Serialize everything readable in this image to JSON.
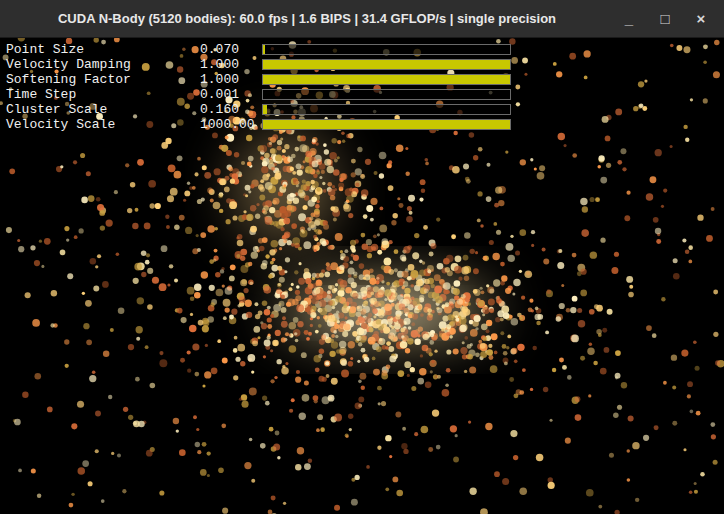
{
  "window": {
    "title": "CUDA N-Body (5120 bodies): 60.0 fps | 1.6 BIPS | 31.4 GFLOP/s | single precision",
    "controls": [
      "_",
      "□",
      "×"
    ]
  },
  "parameters": [
    {
      "label": "Point Size",
      "value": "0.070",
      "level": 0.01
    },
    {
      "label": "Velocity Damping",
      "value": "1.000",
      "level": 1
    },
    {
      "label": "Softening Factor",
      "value": "1.000",
      "level": 1
    },
    {
      "label": "Time Step",
      "value": "0.001",
      "level": 0.0
    },
    {
      "label": "Cluster Scale",
      "value": "0.160",
      "level": 0.015
    },
    {
      "label": "Velocity Scale",
      "value": "1000.00",
      "level": 1
    }
  ]
}
